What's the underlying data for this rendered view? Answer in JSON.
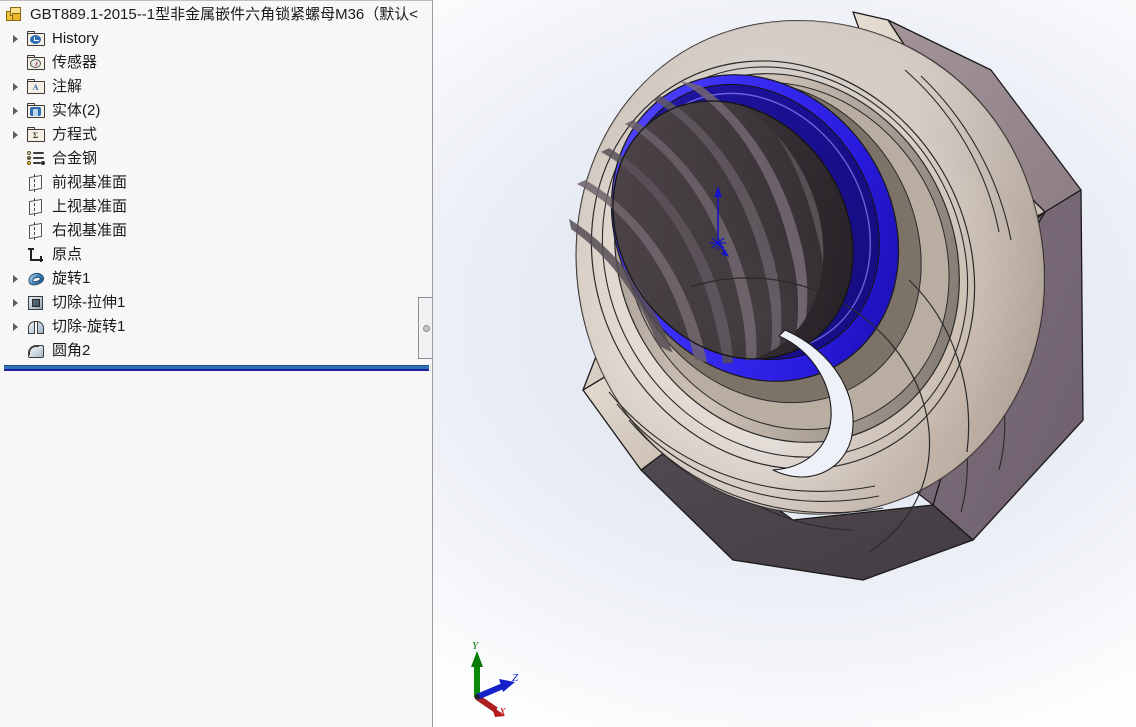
{
  "app": {
    "document_title": "GBT889.1-2015--1型非金属嵌件六角锁紧螺母M36（默认<"
  },
  "feature_tree": {
    "root": {
      "label": "GBT889.1-2015--1型非金属嵌件六角锁紧螺母M36（默认<",
      "icon": "part-icon",
      "expandable": false
    },
    "items": [
      {
        "label": "History",
        "icon": "folder-history-icon",
        "expandable": true,
        "indent": 0
      },
      {
        "label": "传感器",
        "icon": "folder-sensor-icon",
        "expandable": false,
        "indent": 0
      },
      {
        "label": "注解",
        "icon": "folder-annotation-icon",
        "expandable": true,
        "indent": 0
      },
      {
        "label": "实体(2)",
        "icon": "folder-solidbodies-icon",
        "expandable": true,
        "indent": 0
      },
      {
        "label": "方程式",
        "icon": "folder-equations-icon",
        "expandable": true,
        "indent": 0
      },
      {
        "label": "合金钢",
        "icon": "material-icon",
        "expandable": false,
        "indent": 0
      },
      {
        "label": "前视基准面",
        "icon": "plane-icon",
        "expandable": false,
        "indent": 0
      },
      {
        "label": "上视基准面",
        "icon": "plane-icon",
        "expandable": false,
        "indent": 0
      },
      {
        "label": "右视基准面",
        "icon": "plane-icon",
        "expandable": false,
        "indent": 0
      },
      {
        "label": "原点",
        "icon": "origin-icon",
        "expandable": false,
        "indent": 0
      },
      {
        "label": "旋转1",
        "icon": "revolve-icon",
        "expandable": true,
        "indent": 0
      },
      {
        "label": "切除-拉伸1",
        "icon": "cut-extrude-icon",
        "expandable": true,
        "indent": 0
      },
      {
        "label": "切除-旋转1",
        "icon": "cut-revolve-icon",
        "expandable": true,
        "indent": 0
      },
      {
        "label": "圆角2",
        "icon": "fillet-icon",
        "expandable": false,
        "indent": 0
      }
    ],
    "rollback_bar": {
      "visible": true,
      "color": "#2f72b8"
    },
    "splitter": {
      "visible": true
    }
  },
  "viewport": {
    "background_top": "#ffffff",
    "background_mid": "#e2e7f1",
    "model": {
      "name": "hex-lock-nut-m36",
      "colors": {
        "steel_light": "#efe4da",
        "steel_mid": "#cbbfb4",
        "hex_face_mauve": "#7a6a78",
        "hex_face_dark": "#4a4449",
        "hex_face_taupe": "#9d8d93",
        "nylon_insert_blue": "#3b2ef5",
        "nylon_insert_dark": "#1a0fa8",
        "thread_dark": "#3a3338",
        "outline": "#1a1a1a"
      }
    },
    "origin_marker": {
      "visible": true,
      "color": "#1414c8"
    },
    "triad": {
      "axes": [
        {
          "name": "Y",
          "color": "#0a8a0a",
          "label": "Y"
        },
        {
          "name": "Z",
          "color": "#1420c8",
          "label": "Z"
        },
        {
          "name": "X",
          "color": "#c81414",
          "label": "X"
        }
      ]
    }
  }
}
